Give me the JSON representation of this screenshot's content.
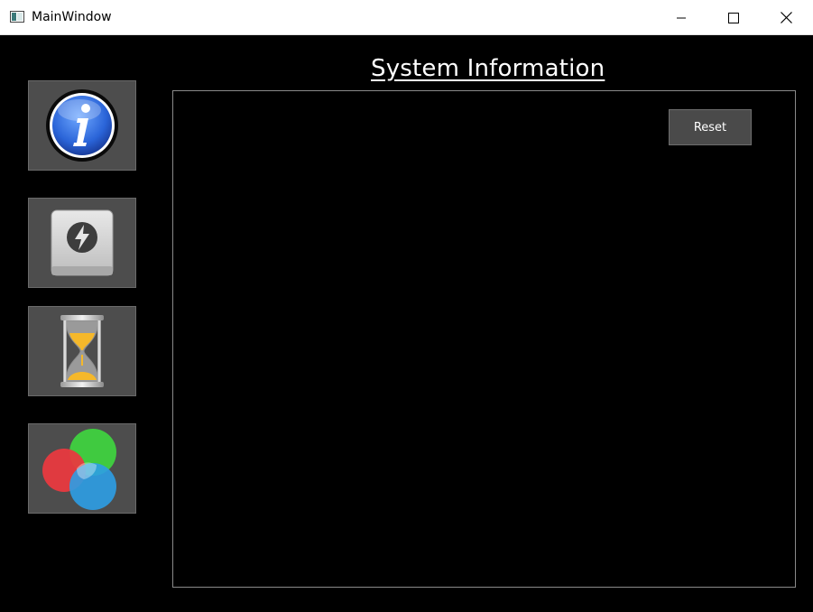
{
  "window": {
    "title": "MainWindow",
    "controls": {
      "minimize_icon": "minimize-icon",
      "maximize_icon": "maximize-icon",
      "close_icon": "close-icon"
    }
  },
  "sidebar": {
    "items": [
      {
        "name": "info",
        "icon": "info-icon"
      },
      {
        "name": "storage",
        "icon": "drive-icon"
      },
      {
        "name": "time",
        "icon": "hourglass-icon"
      },
      {
        "name": "color",
        "icon": "color-circles-icon"
      }
    ]
  },
  "main": {
    "heading": "System Information",
    "reset_label": "Reset"
  },
  "colors": {
    "background": "#000000",
    "button_bg": "#4d4d4d",
    "panel_border": "#8a8a8a",
    "info_blue": "#2a64d8",
    "circle_red": "#e8393f",
    "circle_green": "#3fd13f",
    "circle_blue": "#2e9fe6",
    "sand": "#f5b82a"
  }
}
